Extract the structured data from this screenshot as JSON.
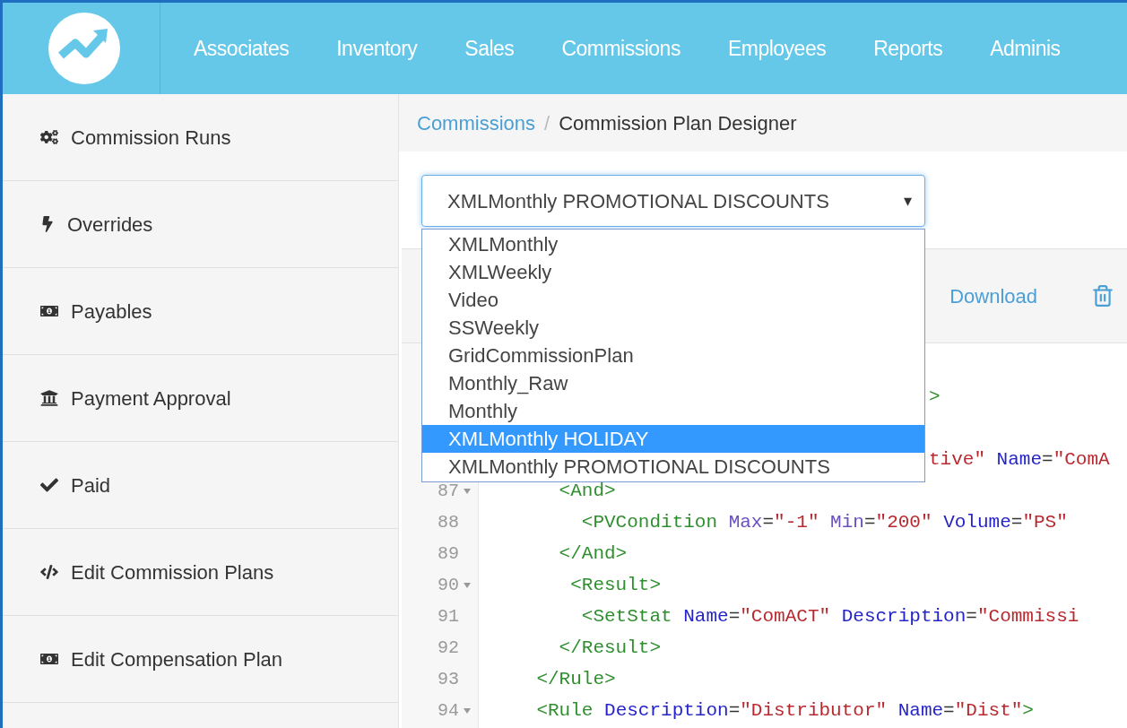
{
  "nav": {
    "items": [
      {
        "label": "Associates"
      },
      {
        "label": "Inventory"
      },
      {
        "label": "Sales"
      },
      {
        "label": "Commissions"
      },
      {
        "label": "Employees"
      },
      {
        "label": "Reports"
      },
      {
        "label": "Adminis"
      }
    ]
  },
  "sidebar": {
    "items": [
      {
        "label": "Commission Runs",
        "kind": "runs"
      },
      {
        "label": "Overrides",
        "kind": "overrides"
      },
      {
        "label": "Payables",
        "kind": "payables"
      },
      {
        "label": "Payment Approval",
        "kind": "approval"
      },
      {
        "label": "Paid",
        "kind": "paid"
      },
      {
        "label": "Edit Commission Plans",
        "kind": "plans"
      },
      {
        "label": "Edit Compensation Plan",
        "kind": "payables"
      }
    ]
  },
  "breadcrumb": [
    {
      "label": "Commissions",
      "kind": "link"
    },
    {
      "label": "/",
      "kind": "separator"
    },
    {
      "label": "Commission Plan Designer",
      "kind": "current"
    }
  ],
  "plan_select": {
    "value": "XMLMonthly PROMOTIONAL DISCOUNTS",
    "caret": "▾",
    "expanded": true,
    "options": [
      {
        "label": "XMLMonthly",
        "highlighted": false
      },
      {
        "label": "XMLWeekly",
        "highlighted": false
      },
      {
        "label": "Video",
        "highlighted": false
      },
      {
        "label": "SSWeekly",
        "highlighted": false
      },
      {
        "label": "GridCommissionPlan",
        "highlighted": false
      },
      {
        "label": "Monthly_Raw",
        "highlighted": false
      },
      {
        "label": "Monthly",
        "highlighted": false
      },
      {
        "label": "XMLMonthly HOLIDAY",
        "highlighted": true
      },
      {
        "label": "XMLMonthly PROMOTIONAL DISCOUNTS",
        "highlighted": false
      }
    ]
  },
  "toolbar": {
    "download_label": "Download"
  },
  "editor": {
    "lines": [
      {
        "kind": "tail",
        "skip_before": false,
        "tokens": [
          {
            "kind": "tag",
            "text": ">"
          }
        ]
      },
      {
        "kind": "tail",
        "skip_before": true,
        "tokens": [
          {
            "kind": "value",
            "text": "tive\""
          },
          {
            "kind": "attr",
            "text": " Name"
          },
          {
            "kind": "plain",
            "text": "="
          },
          {
            "kind": "value",
            "text": "\"ComA"
          }
        ]
      },
      {
        "kind": "code",
        "number": "87",
        "fold": true,
        "tokens": [
          {
            "kind": "tag",
            "text": "      <And>"
          }
        ]
      },
      {
        "kind": "code",
        "number": "88",
        "fold": false,
        "tokens": [
          {
            "kind": "tag",
            "text": "        <PVCondition"
          },
          {
            "kind": "attr2",
            "text": " Max"
          },
          {
            "kind": "plain",
            "text": "="
          },
          {
            "kind": "value",
            "text": "\"-1\""
          },
          {
            "kind": "attr2",
            "text": " Min"
          },
          {
            "kind": "plain",
            "text": "="
          },
          {
            "kind": "value",
            "text": "\"200\""
          },
          {
            "kind": "attr",
            "text": " Volume"
          },
          {
            "kind": "plain",
            "text": "="
          },
          {
            "kind": "value",
            "text": "\"PS\""
          }
        ]
      },
      {
        "kind": "code",
        "number": "89",
        "fold": false,
        "tokens": [
          {
            "kind": "tag",
            "text": "      </And>"
          }
        ]
      },
      {
        "kind": "code",
        "number": "90",
        "fold": true,
        "tokens": [
          {
            "kind": "tag",
            "text": "       <Result>"
          }
        ]
      },
      {
        "kind": "code",
        "number": "91",
        "fold": false,
        "tokens": [
          {
            "kind": "tag",
            "text": "        <SetStat"
          },
          {
            "kind": "attr",
            "text": " Name"
          },
          {
            "kind": "plain",
            "text": "="
          },
          {
            "kind": "value",
            "text": "\"ComACT\""
          },
          {
            "kind": "attr",
            "text": " Description"
          },
          {
            "kind": "plain",
            "text": "="
          },
          {
            "kind": "value",
            "text": "\"Commissi"
          }
        ]
      },
      {
        "kind": "code",
        "number": "92",
        "fold": false,
        "tokens": [
          {
            "kind": "tag",
            "text": "      </Result>"
          }
        ]
      },
      {
        "kind": "code",
        "number": "93",
        "fold": false,
        "tokens": [
          {
            "kind": "tag",
            "text": "    </Rule>"
          }
        ]
      },
      {
        "kind": "code",
        "number": "94",
        "fold": true,
        "tokens": [
          {
            "kind": "tag",
            "text": "    <Rule"
          },
          {
            "kind": "attr",
            "text": " Description"
          },
          {
            "kind": "plain",
            "text": "="
          },
          {
            "kind": "value",
            "text": "\"Distributor\""
          },
          {
            "kind": "attr",
            "text": " Name"
          },
          {
            "kind": "plain",
            "text": "="
          },
          {
            "kind": "value",
            "text": "\"Dist\""
          },
          {
            "kind": "tag",
            "text": ">"
          }
        ]
      }
    ]
  }
}
